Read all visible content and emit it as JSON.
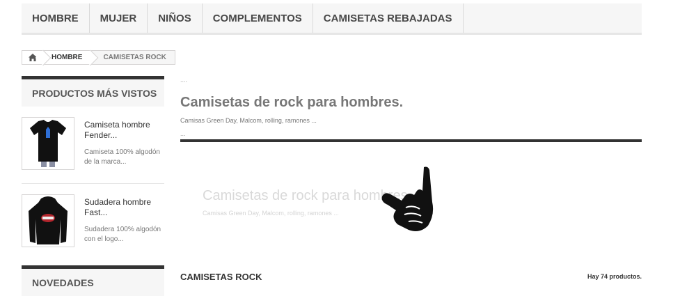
{
  "topnav": {
    "items": [
      {
        "label": "HOMBRE"
      },
      {
        "label": "MUJER"
      },
      {
        "label": "NIÑOS"
      },
      {
        "label": "COMPLEMENTOS"
      },
      {
        "label": "CAMISETAS REBAJADAS"
      }
    ]
  },
  "breadcrumb": {
    "home_icon": "home-icon",
    "items": [
      {
        "label": "HOMBRE"
      },
      {
        "label": "CAMISETAS ROCK"
      }
    ]
  },
  "sidebar": {
    "most_viewed": {
      "title": "PRODUCTOS MÁS VISTOS",
      "products": [
        {
          "name": "Camiseta hombre Fender...",
          "desc": "Camiseta 100% algodón de la marca..."
        },
        {
          "name": "Sudadera hombre Fast...",
          "desc": "Sudadera 100% algodón con el logo..."
        }
      ]
    },
    "news": {
      "title": "NOVEDADES"
    }
  },
  "main": {
    "dots_top": "....",
    "title": "Camisetas de rock para hombres.",
    "subtitle": "Camisas Green Day, Malcom, rolling, ramones ...",
    "dots_bottom": "...",
    "banner": {
      "title": "Camisetas de rock para hombres.",
      "subtitle": "Camisas Green Day, Malcom, rolling, ramones ..."
    },
    "category_heading": "CAMISETAS ROCK",
    "product_count": "Hay 74 productos."
  },
  "colors": {
    "nav_bg": "#f6f6f6",
    "accent_dark": "#333333"
  }
}
